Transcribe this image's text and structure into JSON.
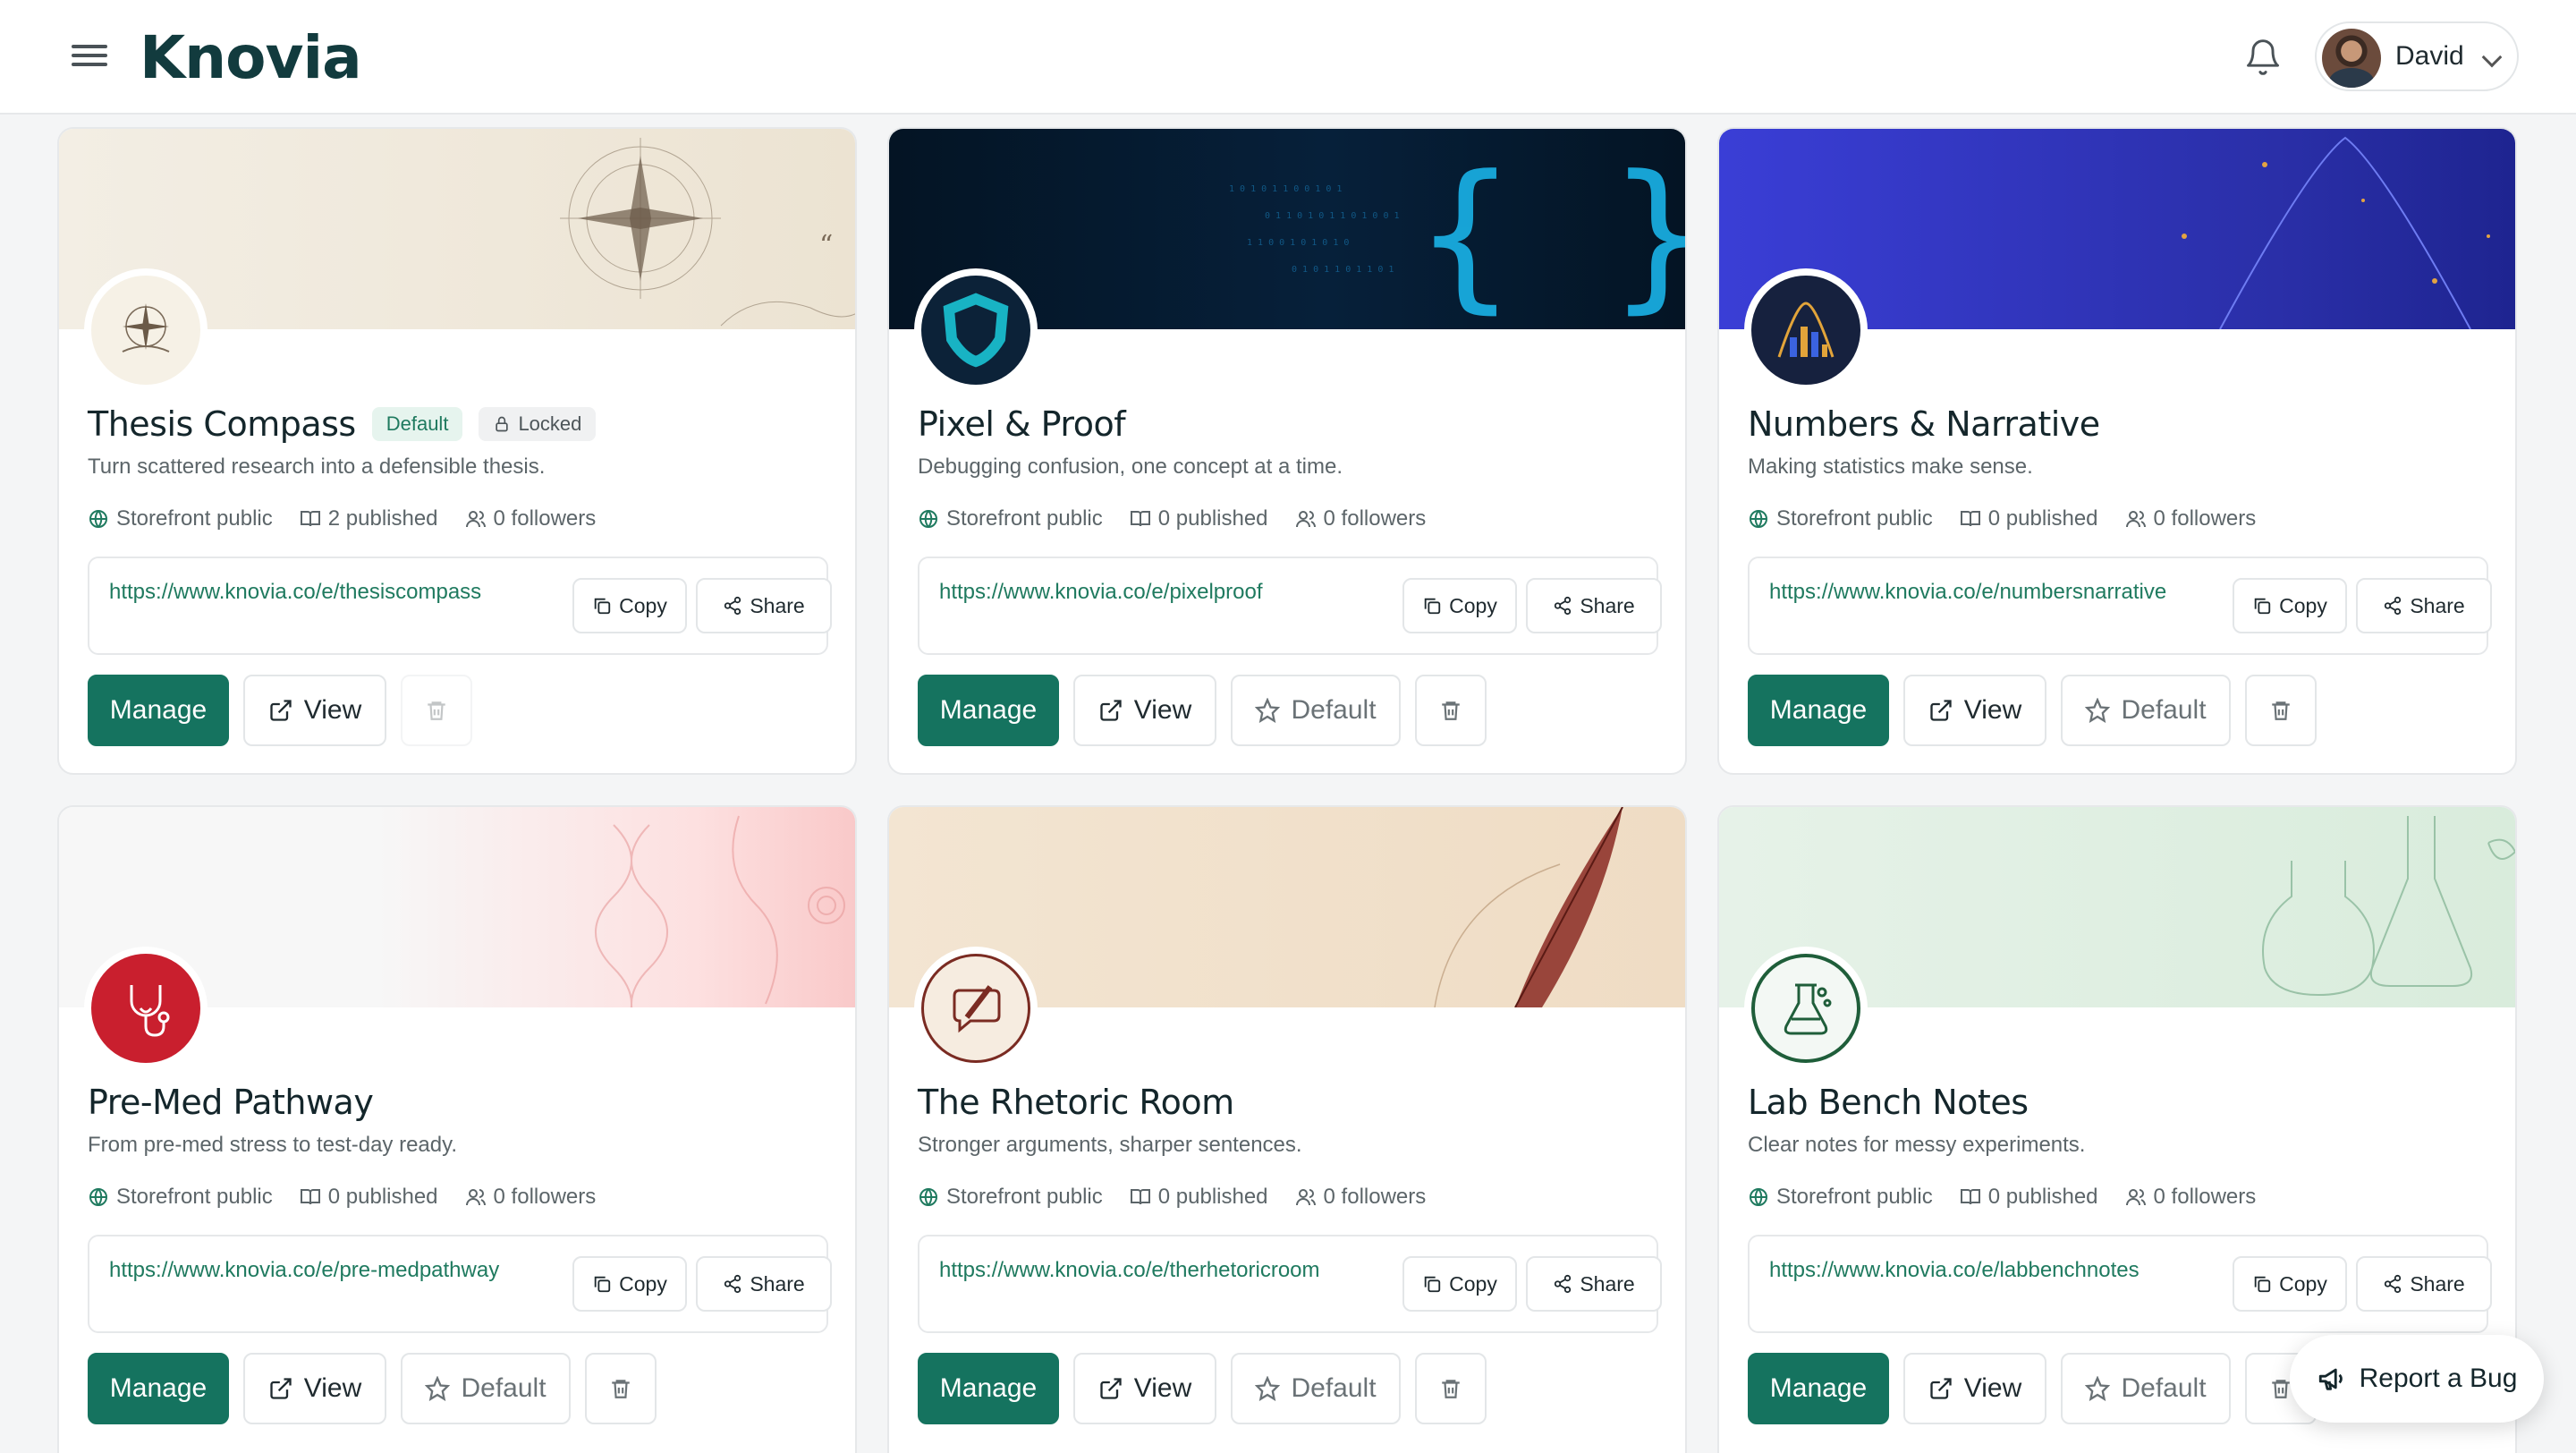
{
  "header": {
    "logo": "Knovia",
    "user_name": "David"
  },
  "cards": [
    {
      "title": "Thesis Compass",
      "badge_default": "Default",
      "badge_locked": "Locked",
      "description": "Turn scattered research into a defensible thesis.",
      "storefront": "Storefront public",
      "published": "2 published",
      "followers": "0 followers",
      "url": "https://www.knovia.co/e/thesiscompass",
      "copy": "Copy",
      "share": "Share",
      "manage": "Manage",
      "view": "View"
    },
    {
      "title": "Pixel & Proof",
      "description": "Debugging confusion, one concept at a time.",
      "storefront": "Storefront public",
      "published": "0 published",
      "followers": "0 followers",
      "url": "https://www.knovia.co/e/pixelproof",
      "copy": "Copy",
      "share": "Share",
      "manage": "Manage",
      "view": "View",
      "default": "Default"
    },
    {
      "title": "Numbers & Narrative",
      "description": "Making statistics make sense.",
      "storefront": "Storefront public",
      "published": "0 published",
      "followers": "0 followers",
      "url": "https://www.knovia.co/e/numbersnarrative",
      "copy": "Copy",
      "share": "Share",
      "manage": "Manage",
      "view": "View",
      "default": "Default"
    },
    {
      "title": "Pre-Med Pathway",
      "description": "From pre-med stress to test-day ready.",
      "storefront": "Storefront public",
      "published": "0 published",
      "followers": "0 followers",
      "url": "https://www.knovia.co/e/pre-medpathway",
      "copy": "Copy",
      "share": "Share",
      "manage": "Manage",
      "view": "View",
      "default": "Default"
    },
    {
      "title": "The Rhetoric Room",
      "description": "Stronger arguments, sharper sentences.",
      "storefront": "Storefront public",
      "published": "0 published",
      "followers": "0 followers",
      "url": "https://www.knovia.co/e/therhetoricroom",
      "copy": "Copy",
      "share": "Share",
      "manage": "Manage",
      "view": "View",
      "default": "Default"
    },
    {
      "title": "Lab Bench Notes",
      "description": "Clear notes for messy experiments.",
      "storefront": "Storefront public",
      "published": "0 published",
      "followers": "0 followers",
      "url": "https://www.knovia.co/e/labbenchnotes",
      "copy": "Copy",
      "share": "Share",
      "manage": "Manage",
      "view": "View",
      "default": "Default"
    }
  ],
  "report_bug": "Report a Bug",
  "colors": {
    "primary": "#15735f",
    "link": "#1f7a5f",
    "logo": "#123b3e"
  }
}
